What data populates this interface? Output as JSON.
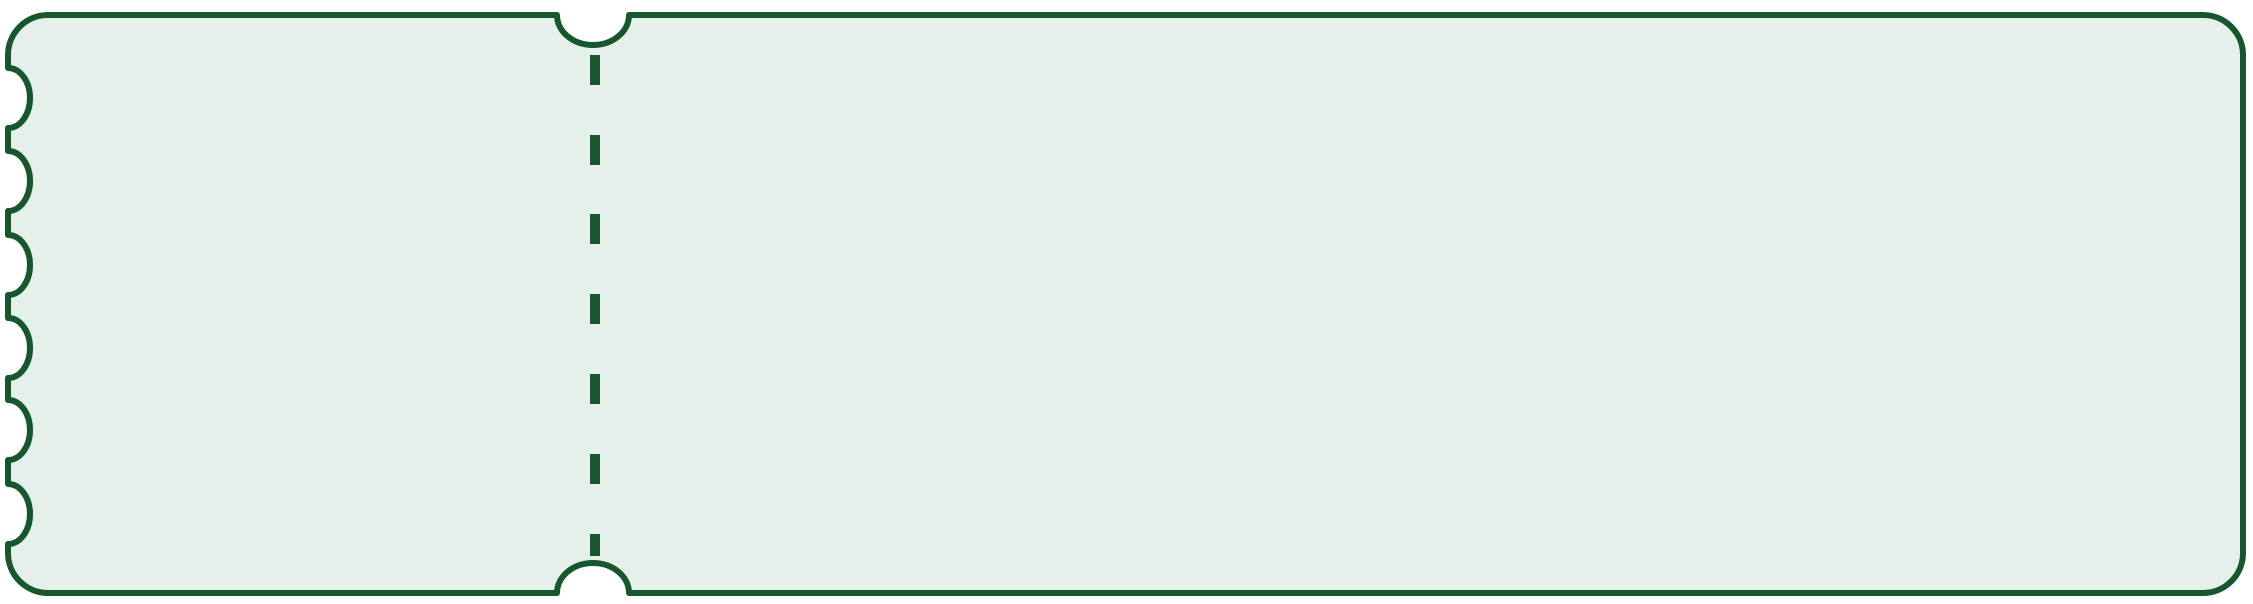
{
  "ticket": {
    "fill_color": "#e6f0ea",
    "stroke_color": "#18562e",
    "perforation_color": "#18562e",
    "left_edge_scallops": 6,
    "perforation_dashes": 7
  }
}
